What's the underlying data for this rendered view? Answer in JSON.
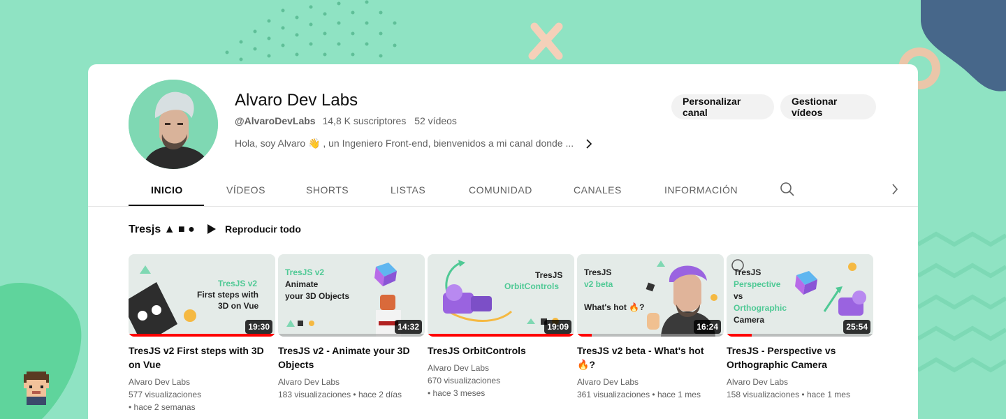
{
  "channel": {
    "name": "Alvaro Dev Labs",
    "handle": "@AlvaroDevLabs",
    "subscribers": "14,8 K suscriptores",
    "video_count": "52 vídeos",
    "description": "Hola, soy Alvaro 👋 , un Ingeniero Front-end, bienvenidos a mi canal donde ...",
    "buttons": {
      "customize": "Personalizar canal",
      "manage": "Gestionar vídeos"
    }
  },
  "tabs": [
    {
      "label": "INICIO",
      "active": true
    },
    {
      "label": "VÍDEOS"
    },
    {
      "label": "SHORTS"
    },
    {
      "label": "LISTAS"
    },
    {
      "label": "COMUNIDAD"
    },
    {
      "label": "CANALES"
    },
    {
      "label": "INFORMACIÓN"
    }
  ],
  "shelf": {
    "title": "Tresjs ▲ ■ ●",
    "play_all": "Reproducir todo"
  },
  "videos": [
    {
      "title": "TresJS v2 First steps with 3D on Vue",
      "channel": "Alvaro Dev Labs",
      "views": "577 visualizaciones",
      "age": "• hace 2 semanas",
      "duration": "19:30",
      "progress": 1.0,
      "thumb_lines": [
        "TresJS v2",
        "First steps with",
        "3D on Vue"
      ]
    },
    {
      "title": "TresJS v2 - Animate your 3D Objects",
      "channel": "Alvaro Dev Labs",
      "views": "183 visualizaciones",
      "age": "• hace 2 días",
      "duration": "14:32",
      "progress": 0.0,
      "thumb_lines": [
        "TresJS v2",
        "Animate",
        "your 3D Objects"
      ]
    },
    {
      "title": "TresJS OrbitControls",
      "channel": "Alvaro Dev Labs",
      "views": "670 visualizaciones",
      "age": "• hace 3 meses",
      "duration": "19:09",
      "progress": 1.0,
      "thumb_lines": [
        "TresJS",
        "OrbitControls"
      ]
    },
    {
      "title": "TresJS v2 beta - What's hot 🔥?",
      "channel": "Alvaro Dev Labs",
      "views": "361 visualizaciones",
      "age": "• hace 1 mes",
      "duration": "16:24",
      "progress": 0.1,
      "thumb_lines": [
        "TresJS",
        "v2 beta",
        "What's hot 🔥?"
      ]
    },
    {
      "title": "TresJS - Perspective vs Orthographic Camera",
      "channel": "Alvaro Dev Labs",
      "views": "158 visualizaciones",
      "age": "• hace 1 mes",
      "duration": "25:54",
      "progress": 0.17,
      "thumb_lines": [
        "TresJS",
        "Perspective",
        "vs",
        "Orthographic",
        "Camera"
      ]
    }
  ],
  "colors": {
    "background": "#8fe3c3",
    "accent_green": "#4fc995",
    "progress_red": "#ff0000"
  }
}
